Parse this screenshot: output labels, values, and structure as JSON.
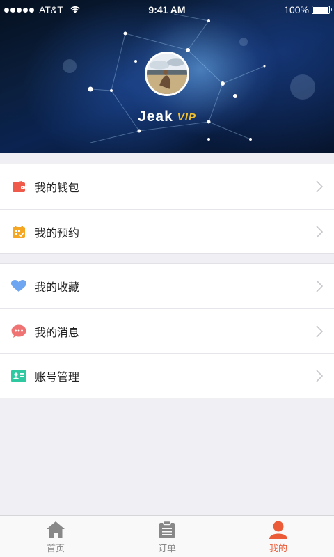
{
  "status_bar": {
    "carrier": "AT&T",
    "time": "9:41 AM",
    "battery": "100%"
  },
  "profile": {
    "username": "Jeak",
    "vip_label": "VIP"
  },
  "menu": {
    "group1": [
      {
        "label": "我的钱包",
        "icon": "wallet-icon",
        "color": "#f05a4a"
      },
      {
        "label": "我的预约",
        "icon": "calendar-icon",
        "color": "#f5a623"
      }
    ],
    "group2": [
      {
        "label": "我的收藏",
        "icon": "heart-icon",
        "color": "#6ea6f2"
      },
      {
        "label": "我的消息",
        "icon": "message-icon",
        "color": "#f07373"
      },
      {
        "label": "账号管理",
        "icon": "id-card-icon",
        "color": "#2ec9a0"
      }
    ]
  },
  "tab_bar": {
    "tabs": [
      {
        "label": "首页",
        "icon": "home-icon"
      },
      {
        "label": "订单",
        "icon": "clipboard-icon"
      },
      {
        "label": "我的",
        "icon": "user-icon",
        "active": true
      }
    ],
    "active_color": "#ec5b38",
    "inactive_color": "#888888"
  }
}
